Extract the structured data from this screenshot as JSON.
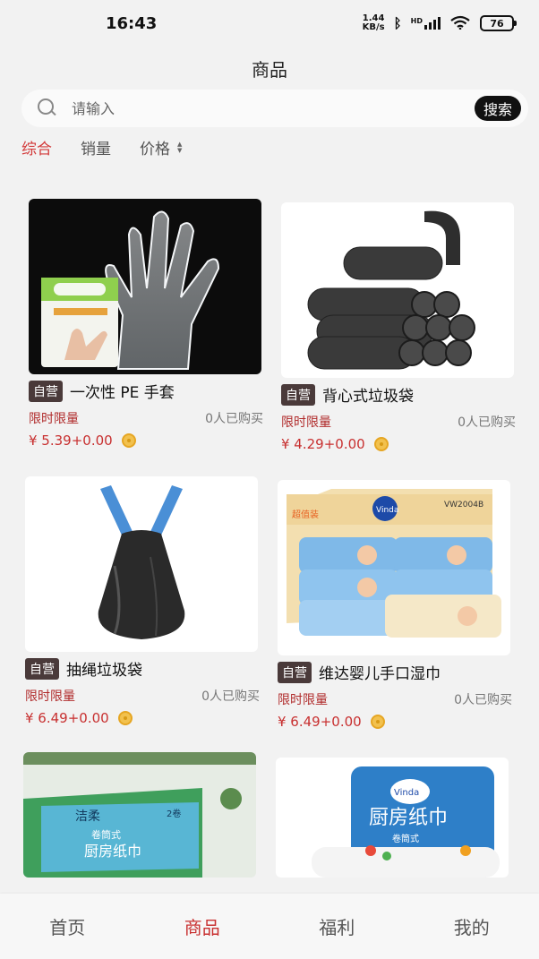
{
  "status_bar": {
    "time": "16:43",
    "net_speed_value": "1.44",
    "net_speed_unit": "KB/s",
    "hd_label": "HD",
    "battery": "76",
    "icons": [
      "bluetooth-icon",
      "signal-icon",
      "wifi-icon",
      "battery-icon"
    ]
  },
  "header": {
    "title": "商品"
  },
  "search": {
    "placeholder": "请输入",
    "value": "",
    "button_label": "搜索"
  },
  "sort_bar": {
    "items": [
      {
        "label": "综合",
        "active": true
      },
      {
        "label": "销量",
        "active": false
      },
      {
        "label": "价格",
        "active": false
      }
    ]
  },
  "products": [
    {
      "badge": "自营",
      "name": "一次性 PE 手套",
      "limit": "限时限量",
      "sold": "0人已购买",
      "price": "¥ 5.39+0.00"
    },
    {
      "badge": "自营",
      "name": "背心式垃圾袋",
      "limit": "限时限量",
      "sold": "0人已购买",
      "price": "¥ 4.29+0.00"
    },
    {
      "badge": "自营",
      "name": "抽绳垃圾袋",
      "limit": "限时限量",
      "sold": "0人已购买",
      "price": "¥ 6.49+0.00"
    },
    {
      "badge": "自营",
      "name": "维达婴儿手口湿巾",
      "limit": "限时限量",
      "sold": "0人已购买",
      "price": "¥ 6.49+0.00"
    },
    {
      "brand": "洁柔",
      "img_text": "厨房纸巾",
      "img_sub": "卷筒式",
      "pack": "2卷"
    },
    {
      "brand": "Vinda",
      "img_text": "厨房纸巾",
      "img_sub": "卷筒式"
    }
  ],
  "product_images": {
    "wipes": {
      "brand": "Vinda",
      "tag": "超值装",
      "code": "VW2004B"
    }
  },
  "bottom_nav": {
    "items": [
      {
        "label": "首页",
        "active": false
      },
      {
        "label": "商品",
        "active": true
      },
      {
        "label": "福利",
        "active": false
      },
      {
        "label": "我的",
        "active": false
      }
    ]
  },
  "colors": {
    "accent": "#c83030",
    "badge": "#4a3a3a",
    "search_button": "#111111"
  }
}
